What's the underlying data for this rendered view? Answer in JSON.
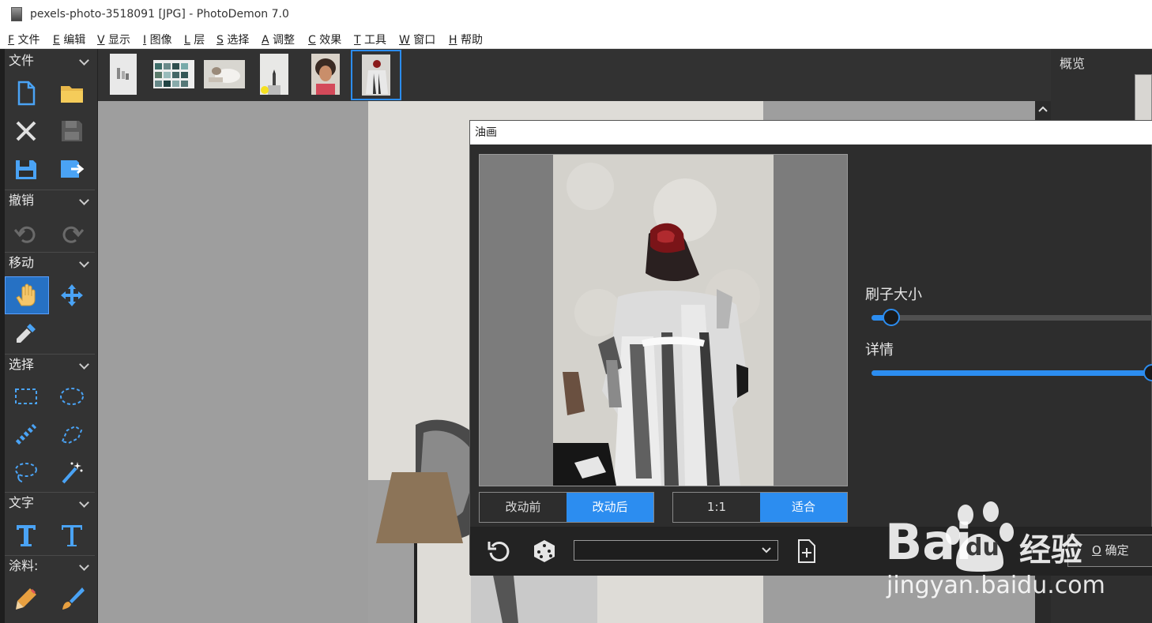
{
  "window": {
    "title": "pexels-photo-3518091 [JPG]  -  PhotoDemon 7.0"
  },
  "menu": [
    {
      "key": "F",
      "label": "文件"
    },
    {
      "key": "E",
      "label": "编辑"
    },
    {
      "key": "V",
      "label": "显示"
    },
    {
      "key": "I",
      "label": "图像"
    },
    {
      "key": "L",
      "label": "层"
    },
    {
      "key": "S",
      "label": "选择"
    },
    {
      "key": "A",
      "label": "调整"
    },
    {
      "key": "C",
      "label": "效果"
    },
    {
      "key": "T",
      "label": "工具"
    },
    {
      "key": "W",
      "label": "窗口"
    },
    {
      "key": "H",
      "label": "帮助"
    }
  ],
  "toolbox": {
    "sections": {
      "file": "文件",
      "undo": "撤销",
      "move": "移动",
      "select": "选择",
      "text": "文字",
      "paint": "涂料:"
    }
  },
  "right_panel": {
    "title": "概览"
  },
  "dialog": {
    "title": "油画",
    "before_label": "改动前",
    "after_label": "改动后",
    "zoom_1to1": "1:1",
    "zoom_fit": "适合",
    "brush_size_label": "刷子大小",
    "brush_size_value": 0.04,
    "detail_label": "详情",
    "detail_value": 1.0,
    "ok_key": "O",
    "ok_label": "确定"
  },
  "watermark": {
    "brand": "Bai",
    "brand2": "du",
    "jingyan": "经验",
    "url": "jingyan.baidu.com"
  },
  "colors": {
    "accent": "#2c8df0",
    "panel": "#333333",
    "canvas": "#9e9e9e"
  }
}
